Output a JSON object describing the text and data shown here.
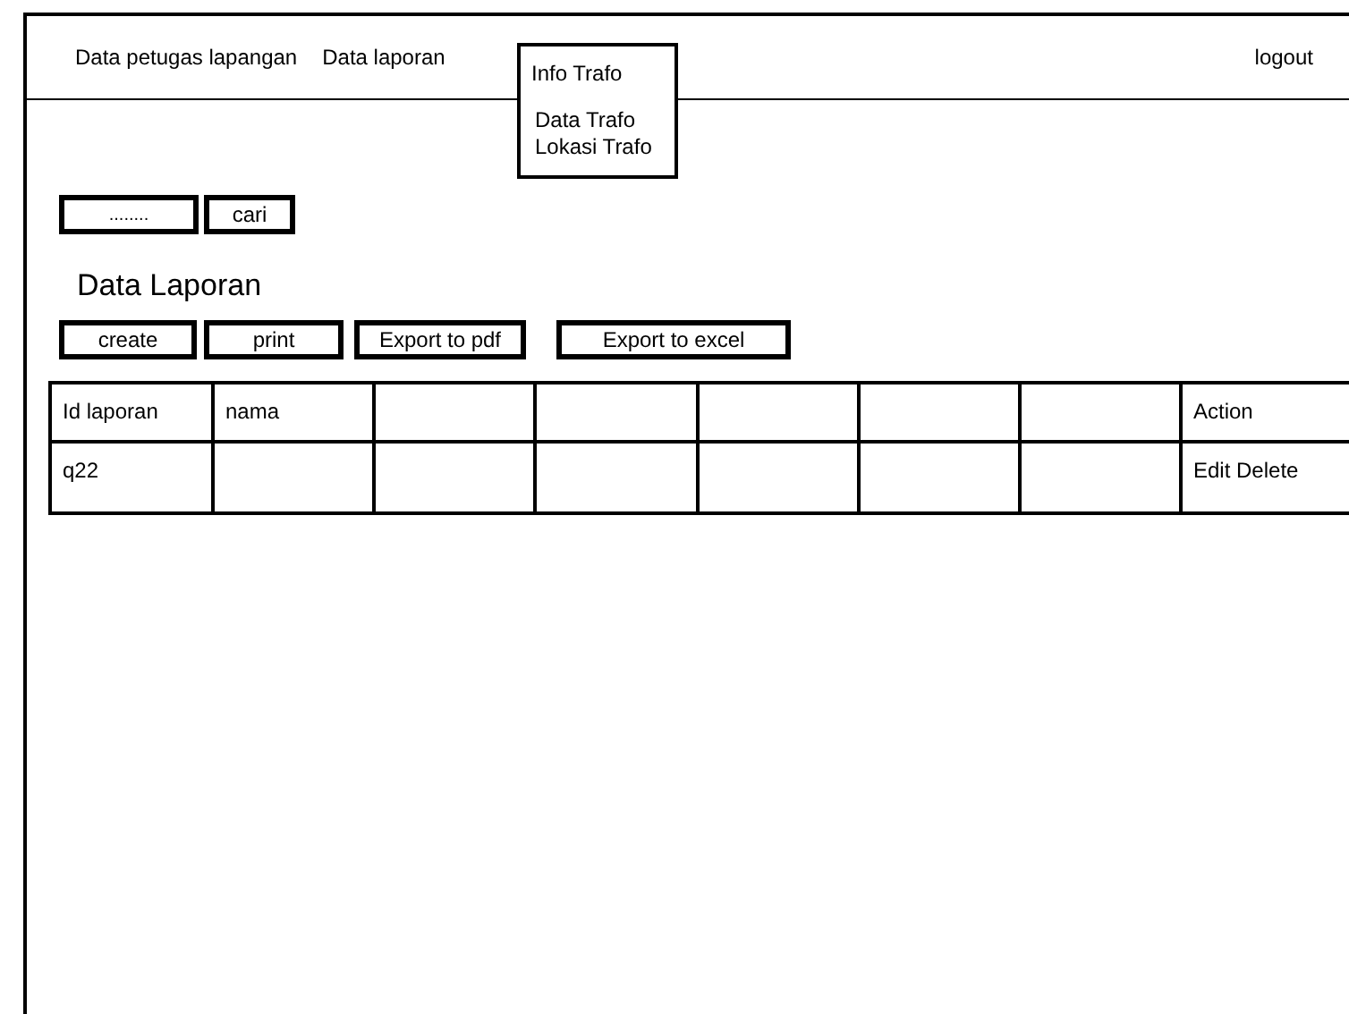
{
  "nav": {
    "items": [
      {
        "label": "Data petugas lapangan"
      },
      {
        "label": "Data laporan"
      }
    ],
    "menu": {
      "label": "Info Trafo",
      "expanded": true,
      "items": [
        {
          "label": "Data Trafo"
        },
        {
          "label": "Lokasi Trafo"
        }
      ]
    },
    "logout": "logout"
  },
  "search": {
    "placeholder": "........",
    "button": "cari"
  },
  "heading": "Data Laporan",
  "actions": [
    "create",
    "print",
    "Export to pdf",
    "Export to excel"
  ],
  "table": {
    "columns": [
      {
        "label": "Id laporan"
      },
      {
        "label": "nama"
      },
      {},
      {},
      {},
      {},
      {},
      {
        "label": "Action"
      }
    ],
    "rows": [
      {
        "cells": [
          {
            "text": "q22"
          },
          {},
          {},
          {},
          {},
          {},
          {},
          {
            "text": "Edit Delete"
          }
        ]
      }
    ]
  }
}
